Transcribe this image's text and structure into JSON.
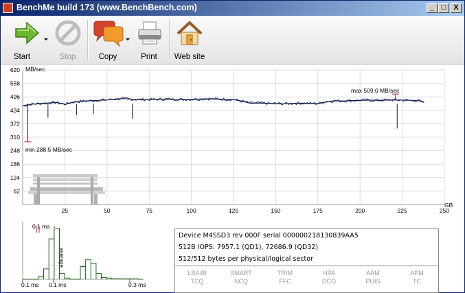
{
  "window": {
    "title": "BenchMe build 173 (www.BenchBench.com)",
    "controls": [
      "_",
      "□",
      "X"
    ]
  },
  "toolbar": {
    "buttons": [
      {
        "label": "Start",
        "icon": "arrow-right-icon",
        "enabled": true
      },
      {
        "label": "Stop",
        "icon": "stop-icon",
        "enabled": false
      },
      {
        "label": "Copy",
        "icon": "speech-bubbles-icon",
        "enabled": true
      },
      {
        "label": "Print",
        "icon": "printer-icon",
        "enabled": true
      },
      {
        "label": "Web site",
        "icon": "house-icon",
        "enabled": true
      }
    ]
  },
  "chart_data": {
    "type": "line",
    "ylabel": "MB/sec",
    "xlabel": "GB",
    "yticks": [
      62,
      124,
      186,
      248,
      310,
      372,
      434,
      496,
      558,
      620
    ],
    "ylim": [
      0,
      620
    ],
    "xticks": [
      25,
      50,
      75,
      100,
      125,
      150,
      175,
      200,
      225,
      250
    ],
    "xlim": [
      0,
      250
    ],
    "max_label": "max 509.0 MB/sec",
    "min_label": "min 288.5 MB/sec",
    "max_value": 509.0,
    "min_value": 288.5,
    "grid": true,
    "series": [
      {
        "x": [
          0,
          5,
          10,
          15,
          20,
          25,
          30,
          35,
          40,
          45,
          50,
          55,
          60,
          65,
          70,
          75,
          80,
          85,
          90,
          95,
          100,
          105,
          110,
          115,
          120,
          125,
          130,
          135,
          140,
          145,
          150,
          155,
          160,
          165,
          170,
          175,
          180,
          185,
          190,
          195,
          200,
          205,
          210,
          215,
          220,
          225,
          230,
          235,
          238
        ],
        "y": [
          455,
          462,
          465,
          468,
          470,
          462,
          472,
          476,
          478,
          480,
          482,
          486,
          488,
          485,
          483,
          484,
          485,
          486,
          485,
          484,
          485,
          486,
          487,
          486,
          485,
          484,
          476,
          467,
          468,
          466,
          465,
          464,
          466,
          467,
          466,
          465,
          474,
          478,
          477,
          479,
          480,
          481,
          480,
          481,
          482,
          481,
          480,
          478,
          470
        ]
      }
    ],
    "dips": [
      {
        "x": 3,
        "y": 290
      },
      {
        "x": 15,
        "y": 400
      },
      {
        "x": 32,
        "y": 412
      },
      {
        "x": 42,
        "y": 418
      },
      {
        "x": 65,
        "y": 395
      },
      {
        "x": 222,
        "y": 350
      }
    ]
  },
  "histogram": {
    "peak_label": "0.1 ms",
    "average_label": "average",
    "x_labels": [
      "0.1 ms",
      "0.1 ms",
      "0.3 ms"
    ],
    "bins": [
      0,
      0,
      0,
      5,
      18,
      70,
      88,
      10,
      2,
      0,
      0,
      22,
      34,
      28,
      10,
      3,
      2,
      1,
      1,
      1,
      1,
      1,
      0
    ]
  },
  "device_info": {
    "line1": "Device M4SSD3 rev 000F serial 000000218130839AA5",
    "line2": "512B IOPS: 7957.1 (QD1), 72686.9 (QD32)",
    "line3": "512/512 bytes per physical/logical sector",
    "features": [
      {
        "top": "LBA48",
        "bottom": "TCQ"
      },
      {
        "top": "SMART",
        "bottom": "NCQ"
      },
      {
        "top": "TRIM",
        "bottom": "FFC"
      },
      {
        "top": "HPA",
        "bottom": "DCO"
      },
      {
        "top": "AAM",
        "bottom": "PUIS"
      },
      {
        "top": "APM",
        "bottom": "TC"
      }
    ]
  }
}
